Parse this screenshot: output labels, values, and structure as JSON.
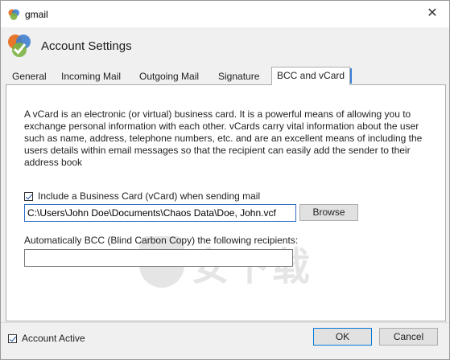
{
  "window": {
    "title": "gmail",
    "close_glyph": "✕"
  },
  "header": {
    "title": "Account Settings"
  },
  "tabs": [
    {
      "label": "General"
    },
    {
      "label": "Incoming Mail"
    },
    {
      "label": "Outgoing Mail"
    },
    {
      "label": "Signature"
    },
    {
      "label": "BCC and vCard",
      "active": true
    }
  ],
  "vcard": {
    "description": "A vCard is an electronic (or virtual) business card. It is a powerful means of allowing you to exchange personal information with each other. vCards carry vital information about the user such as name, address, telephone numbers, etc. and are an excellent means of including the users details within email messages so that the recipient can easily add the sender to their address book",
    "include_label": "Include a Business Card (vCard) when sending mail",
    "include_checked": true,
    "path_value": "C:\\Users\\John Doe\\Documents\\Chaos Data\\Doe, John.vcf",
    "browse_label": "Browse"
  },
  "bcc": {
    "label": "Automatically BCC (Blind Carbon Copy) the following recipients:",
    "value": ""
  },
  "footer": {
    "account_active_label": "Account Active",
    "account_active_checked": true,
    "ok_label": "OK",
    "cancel_label": "Cancel"
  },
  "watermark": {
    "text": "安下载"
  },
  "colors": {
    "focus_blue": "#3a7fd5",
    "button_face": "#e1e1e1",
    "window_bg": "#f0f0f0"
  },
  "icons": {
    "app": "app-logo-icon",
    "close": "close-icon",
    "check": "checkmark-icon"
  }
}
